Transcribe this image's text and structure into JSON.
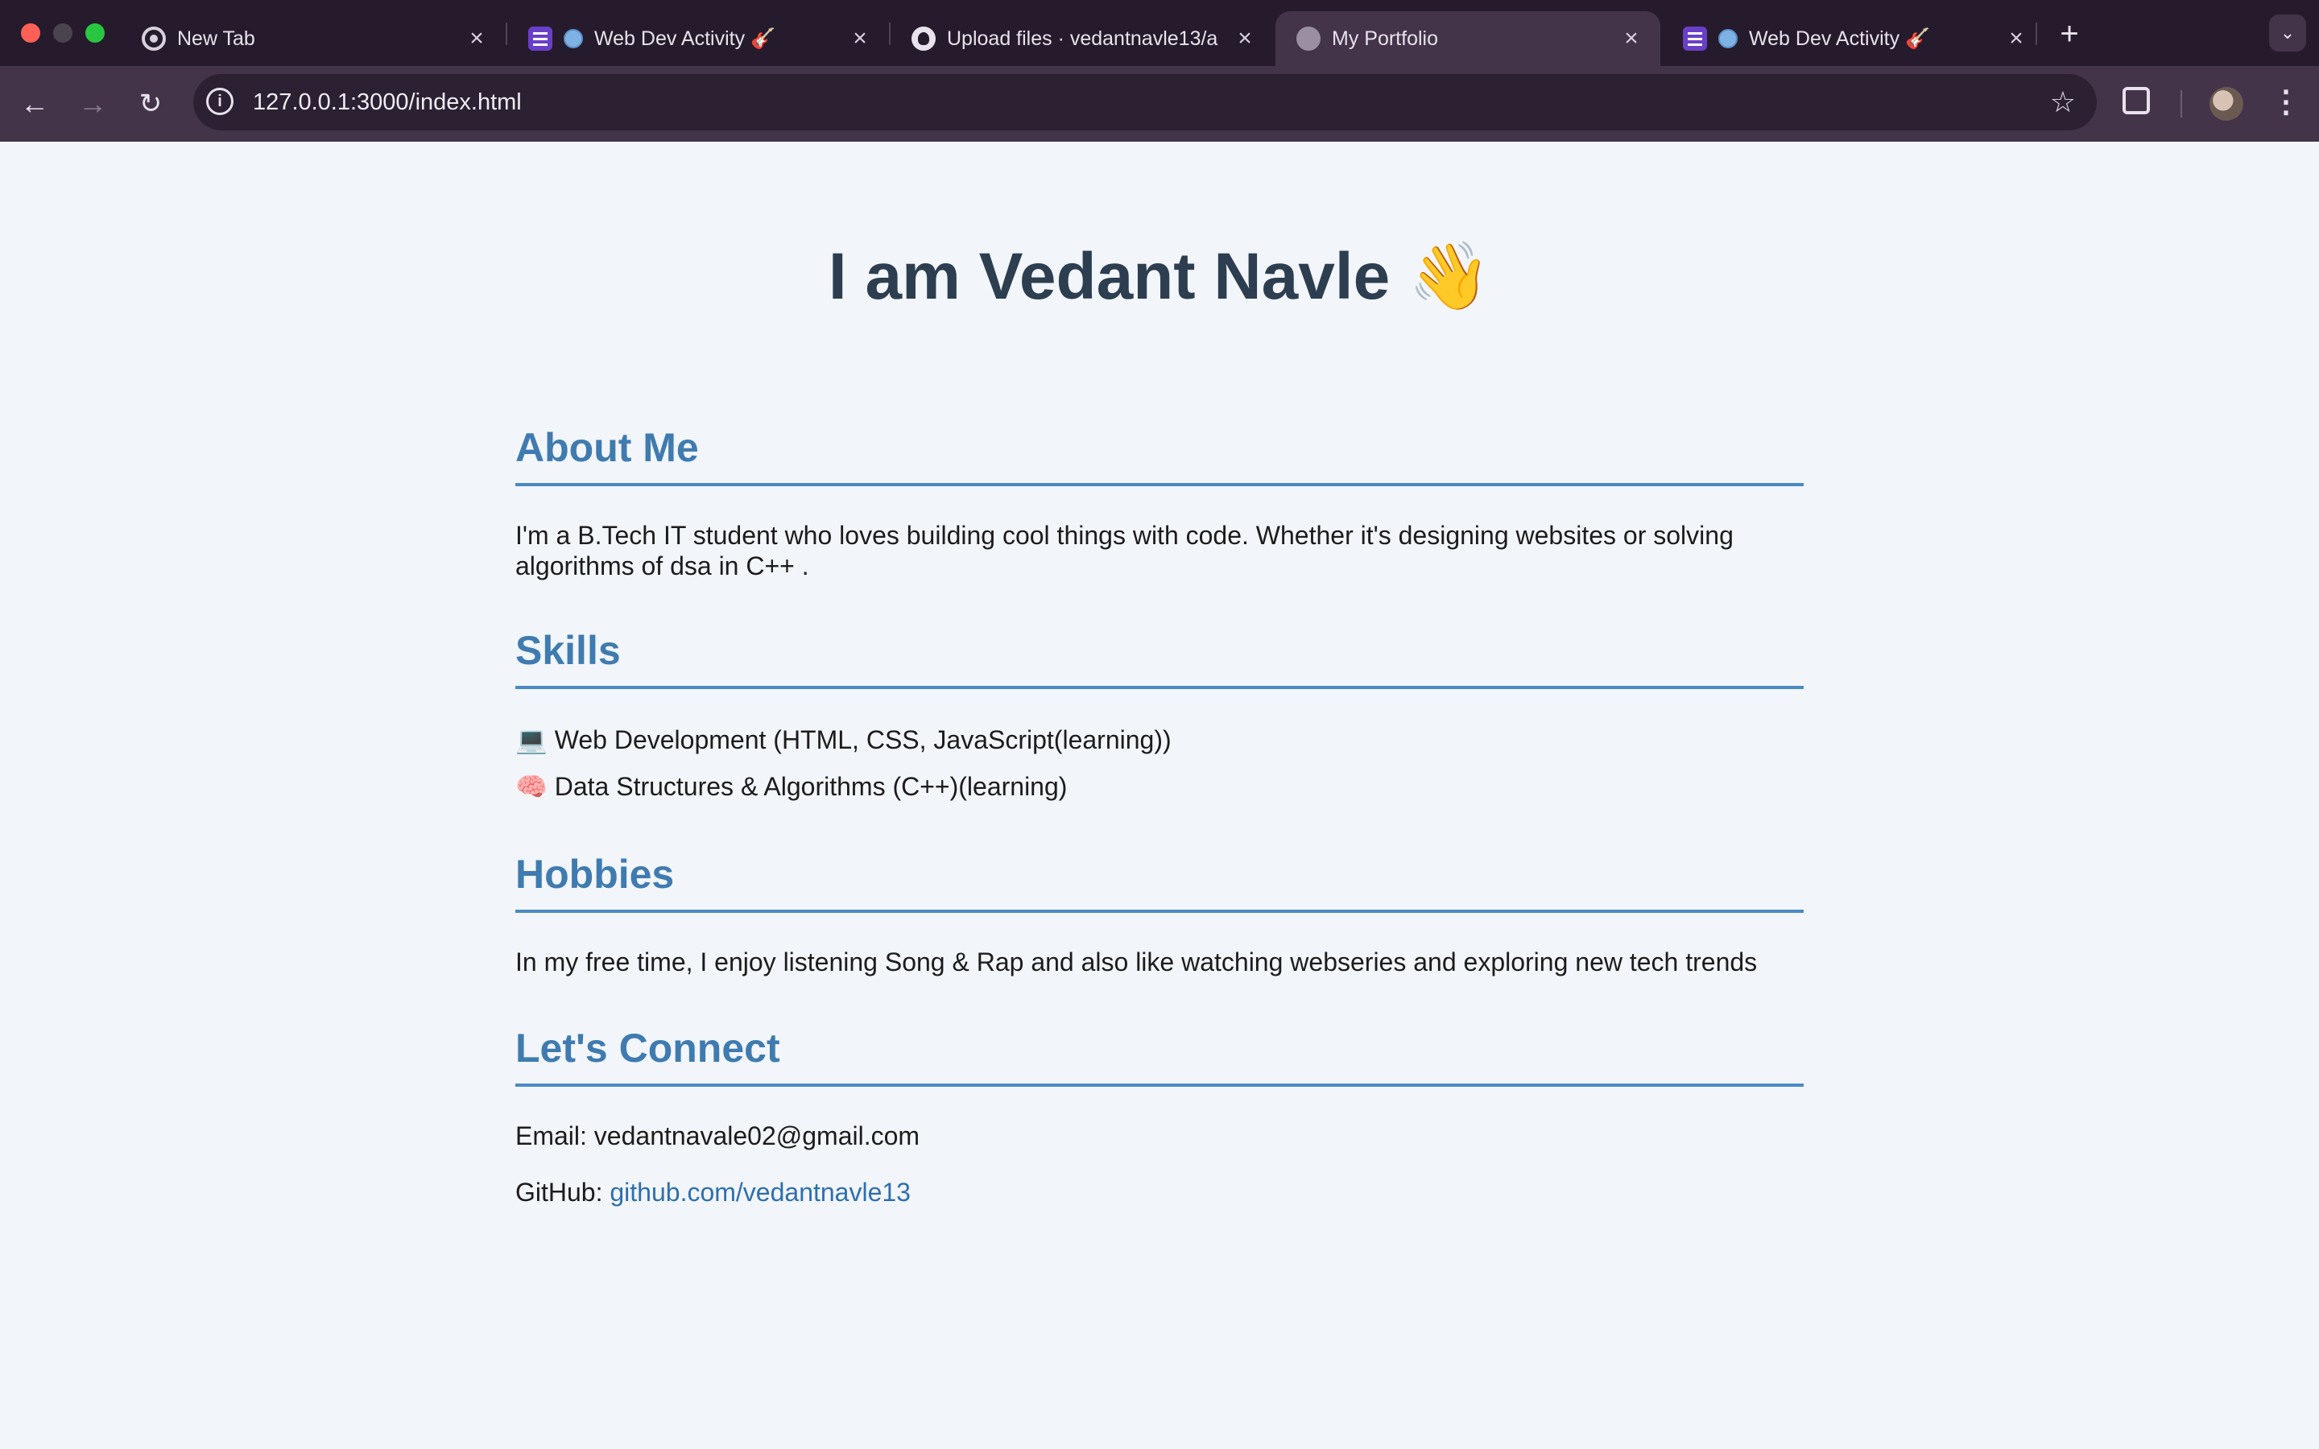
{
  "browser": {
    "tabs": [
      {
        "title": "New Tab",
        "active": false
      },
      {
        "title": "Web Dev Activity 🎸",
        "active": false
      },
      {
        "title": "Upload files · vedantnavle13/a",
        "active": false
      },
      {
        "title": "My Portfolio",
        "active": true
      },
      {
        "title": "Web Dev Activity 🎸",
        "active": false
      }
    ],
    "url": "127.0.0.1:3000/index.html"
  },
  "page": {
    "heading": "I am Vedant Navle",
    "heading_emoji": "👋",
    "sections": {
      "about": {
        "title": "About Me",
        "text": "I'm a B.Tech IT student who loves building cool things with code. Whether it's designing websites or solving algorithms of dsa in C++ ."
      },
      "skills": {
        "title": "Skills",
        "items": [
          {
            "emoji": "💻",
            "text": "Web Development (HTML, CSS, JavaScript(learning))"
          },
          {
            "emoji": "🧠",
            "text": "Data Structures & Algorithms (C++)(learning)"
          }
        ]
      },
      "hobbies": {
        "title": "Hobbies",
        "text": "In my free time, I enjoy listening Song & Rap and also like watching webseries and exploring new tech trends"
      },
      "connect": {
        "title": "Let's Connect",
        "email_label": "Email:",
        "email": "vedantnavale02@gmail.com",
        "github_label": "GitHub:",
        "github_link": "github.com/vedantnavle13"
      }
    }
  },
  "colors": {
    "section_title": "#3f7bb0",
    "heading": "#2c3e50",
    "link": "#2e6fad",
    "page_bg": "#f2f5f9"
  }
}
